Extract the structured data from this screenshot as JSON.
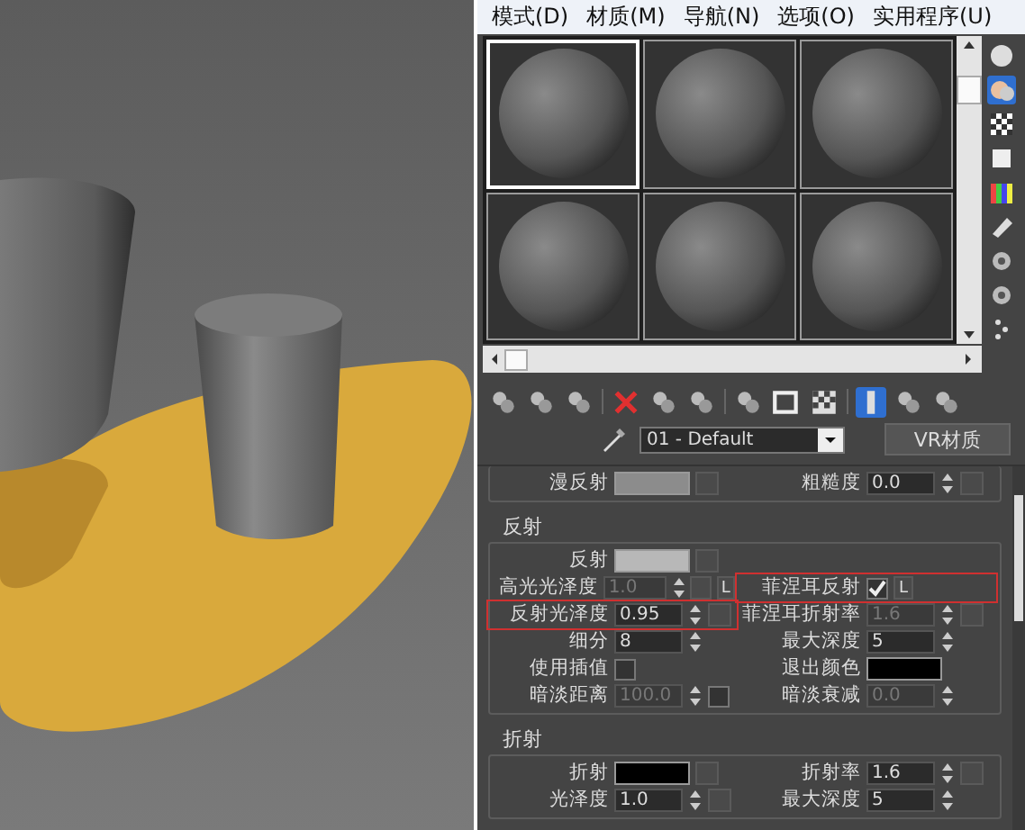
{
  "menu": [
    {
      "label": "模式(D)"
    },
    {
      "label": "材质(M)"
    },
    {
      "label": "导航(N)"
    },
    {
      "label": "选项(O)"
    },
    {
      "label": "实用程序(U)"
    }
  ],
  "samples": [
    {
      "selected": true
    },
    {
      "selected": false
    },
    {
      "selected": false
    },
    {
      "selected": false
    },
    {
      "selected": false
    },
    {
      "selected": false
    }
  ],
  "side_tools": [
    {
      "selected": false
    },
    {
      "selected": true
    },
    {
      "selected": false
    },
    {
      "selected": false
    },
    {
      "selected": false
    },
    {
      "selected": false
    },
    {
      "selected": false
    },
    {
      "selected": false
    },
    {
      "selected": false
    }
  ],
  "toolbar": [
    {
      "selected": false
    },
    {
      "selected": false
    },
    {
      "selected": false
    },
    {
      "selected": false
    },
    {
      "selected": false
    },
    {
      "selected": false
    },
    {
      "selected": false
    },
    {
      "selected": false
    },
    {
      "selected": false
    },
    {
      "selected": true
    },
    {
      "selected": false
    },
    {
      "selected": false
    }
  ],
  "material": {
    "name": "01 - Default",
    "type_button": "VR材质"
  },
  "sections": [
    {
      "rows": [
        {
          "items": [
            {
              "kind": "swatch",
              "label": "漫反射",
              "color": "#8c8c8c",
              "map": true
            },
            {
              "kind": "spinner",
              "label": "粗糙度",
              "value": "0.0",
              "disabled": false,
              "map": true
            }
          ]
        }
      ]
    },
    {
      "title": "反射",
      "rows": [
        {
          "items": [
            {
              "kind": "swatch",
              "label": "反射",
              "color": "#b8b8b8",
              "map": true
            }
          ]
        },
        {
          "items": [
            {
              "kind": "spinner",
              "label": "高光光泽度",
              "value": "1.0",
              "disabled": true,
              "map": true,
              "lock": "L"
            },
            {
              "kind": "check",
              "label": "菲涅耳反射",
              "checked": true,
              "lock": "L",
              "highlighted": true
            }
          ]
        },
        {
          "items": [
            {
              "kind": "spinner",
              "label": "反射光泽度",
              "value": "0.95",
              "disabled": false,
              "map": true,
              "highlighted": true
            },
            {
              "kind": "spinner",
              "label": "菲涅耳折射率",
              "value": "1.6",
              "disabled": true,
              "map": true
            }
          ]
        },
        {
          "items": [
            {
              "kind": "spinner",
              "label": "细分",
              "value": "8",
              "disabled": false
            },
            {
              "kind": "spinner",
              "label": "最大深度",
              "value": "5",
              "disabled": false
            }
          ]
        },
        {
          "items": [
            {
              "kind": "check",
              "label": "使用插值",
              "checked": false
            },
            {
              "kind": "swatch",
              "label": "退出颜色",
              "color": "#000000"
            }
          ]
        },
        {
          "items": [
            {
              "kind": "spinner",
              "label": "暗淡距离",
              "value": "100.0",
              "disabled": true,
              "toggle": false
            },
            {
              "kind": "spinner",
              "label": "暗淡衰减",
              "value": "0.0",
              "disabled": true
            }
          ]
        }
      ]
    },
    {
      "title": "折射",
      "rows": [
        {
          "items": [
            {
              "kind": "swatch",
              "label": "折射",
              "color": "#000000",
              "map": true
            },
            {
              "kind": "spinner",
              "label": "折射率",
              "value": "1.6",
              "disabled": false,
              "map": true
            }
          ]
        },
        {
          "items": [
            {
              "kind": "spinner",
              "label": "光泽度",
              "value": "1.0",
              "disabled": false,
              "map": true
            },
            {
              "kind": "spinner",
              "label": "最大深度",
              "value": "5",
              "disabled": false
            }
          ]
        }
      ]
    }
  ]
}
